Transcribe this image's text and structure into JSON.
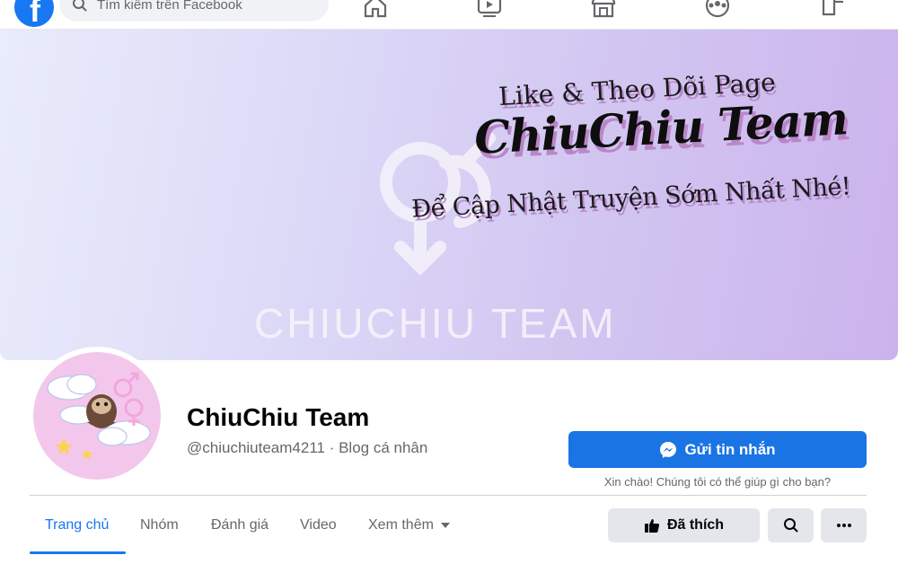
{
  "nav": {
    "search_placeholder": "Tìm kiếm trên Facebook",
    "logo_letter": "f"
  },
  "cover": {
    "line1": "Like & Theo Dõi Page",
    "line2": "ChiuChiu Team",
    "line3": "Để Cập Nhật Truyện Sớm Nhất Nhé!",
    "brand": "CHIUCHIU TEAM"
  },
  "profile": {
    "name": "ChiuChiu Team",
    "meta": "@chiuchiuteam4211 · Blog cá nhân"
  },
  "actions": {
    "message_label": "Gửi tin nhắn",
    "greeting": "Xin chào! Chúng tôi có thể giúp gì cho bạn?",
    "liked_label": "Đã thích"
  },
  "tabs": [
    "Trang chủ",
    "Nhóm",
    "Đánh giá",
    "Video",
    "Xem thêm"
  ],
  "active_tab": "Trang chủ",
  "colors": {
    "accent": "#1877f2",
    "button_blue": "#1b74e4",
    "secondary_bg": "#e4e6eb",
    "muted_text": "#65676b"
  },
  "icons": [
    "facebook-logo-icon",
    "search-icon",
    "home-icon",
    "watch-icon",
    "marketplace-icon",
    "groups-icon",
    "gaming-icon",
    "messenger-icon",
    "thumbs-up-icon",
    "more-icon"
  ]
}
